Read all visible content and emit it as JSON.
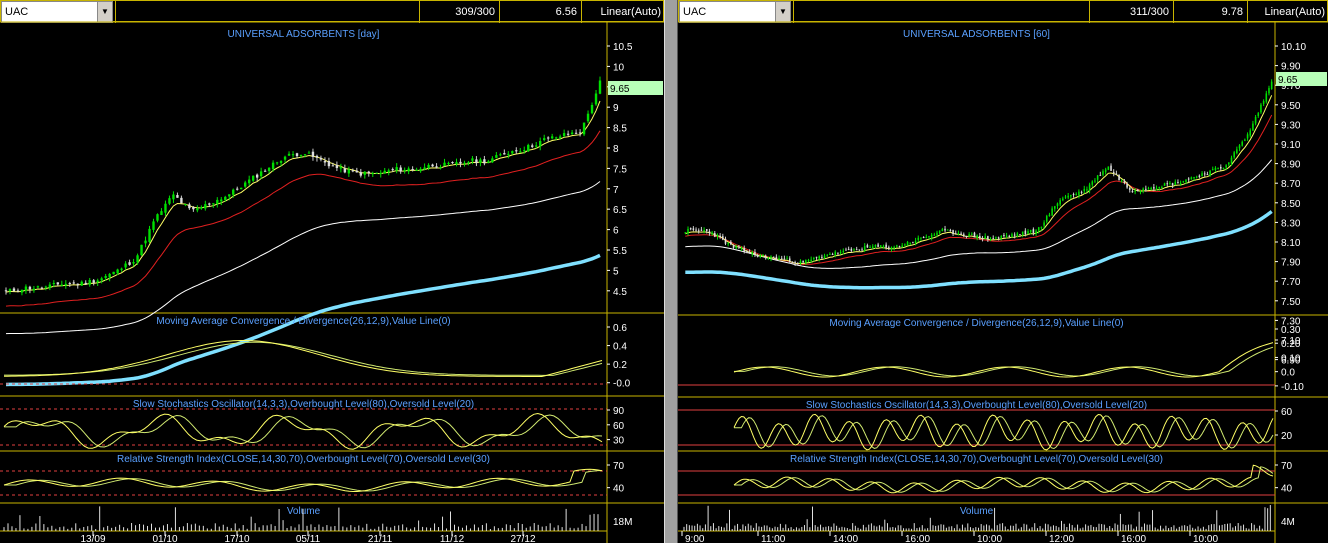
{
  "left": {
    "symbol": "UAC",
    "count": "309/300",
    "value": "6.56",
    "scale": "Linear(Auto)",
    "title": "UNIVERSAL ADSORBENTS [day]",
    "price_badge": "9.65",
    "price_ticks": [
      "10.5",
      "10",
      "9.5",
      "9",
      "8.5",
      "8",
      "7.5",
      "7",
      "6.5",
      "6",
      "5.5",
      "5",
      "4.5"
    ],
    "macd_title": "Moving Average Convergence / Divergence(26,12,9),Value Line(0)",
    "macd_ticks": [
      "0.6",
      "0.4",
      "0.2",
      "-0.0"
    ],
    "stoch_title": "Slow Stochastics Oscillator(14,3,3),Overbought Level(80),Oversold Level(20)",
    "stoch_ticks": [
      "90",
      "60",
      "30"
    ],
    "rsi_title": "Relative Strength Index(CLOSE,14,30,70),Overbought Level(70),Oversold Level(30)",
    "rsi_ticks": [
      "70",
      "40"
    ],
    "volume_title": "Volume",
    "volume_tick": "18M",
    "dates": [
      "13/09",
      "01/10",
      "17/10",
      "05/11",
      "21/11",
      "11/12",
      "27/12"
    ]
  },
  "right": {
    "symbol": "UAC",
    "count": "311/300",
    "value": "9.78",
    "scale": "Linear(Auto)",
    "title": "UNIVERSAL ADSORBENTS [60]",
    "price_badge": "9.65",
    "price_ticks": [
      "10.10",
      "9.90",
      "9.70",
      "9.50",
      "9.30",
      "9.10",
      "8.90",
      "8.70",
      "8.50",
      "8.30",
      "8.10",
      "7.90",
      "7.70",
      "7.50",
      "7.30",
      "7.10",
      "6.90"
    ],
    "macd_title": "Moving Average Convergence / Divergence(26,12,9),Value Line(0)",
    "macd_ticks": [
      "0.30",
      "0.20",
      "0.10",
      "0.0",
      "-0.10"
    ],
    "stoch_title": "Slow Stochastics Oscillator(14,3,3),Overbought Level(80),Oversold Level(20)",
    "stoch_ticks": [
      "60",
      "20"
    ],
    "rsi_title": "Relative Strength Index(CLOSE,14,30,70),Overbought Level(70),Oversold Level(30)",
    "rsi_ticks": [
      "70",
      "40"
    ],
    "volume_title": "Volume",
    "volume_tick": "4M",
    "times": [
      "9:00",
      "11:00",
      "14:00",
      "16:00",
      "10:00",
      "12:00",
      "16:00",
      "10:00"
    ]
  },
  "colors": {
    "up": "#00e000",
    "down": "#ff3030",
    "ma_fast": "#ffff66",
    "ma_mid": "#e02020",
    "ma_slow": "#ffffff",
    "ma_long": "#7fe0ff",
    "title": "#5aa0ff",
    "badge": "#b8ffb8",
    "osc_main": "#ffff66",
    "osc_signal": "#cfe870",
    "level": "#e04040",
    "frame": "#c8b400"
  },
  "chart_data": [
    {
      "type": "candlestick",
      "title": "UNIVERSAL ADSORBENTS [day]",
      "x_labels": [
        "13/09",
        "01/10",
        "17/10",
        "05/11",
        "21/11",
        "11/12",
        "27/12"
      ],
      "ylim": [
        4.3,
        10.7
      ],
      "close_path": [
        4.7,
        4.8,
        4.8,
        4.9,
        4.9,
        5.0,
        5.2,
        5.5,
        6.4,
        7.0,
        6.6,
        6.8,
        7.0,
        7.3,
        7.6,
        7.9,
        8.0,
        7.8,
        7.6,
        7.5,
        7.5,
        7.6,
        7.6,
        7.7,
        7.7,
        7.8,
        7.8,
        8.0,
        8.1,
        8.3,
        8.4,
        8.5,
        9.65
      ],
      "last_price": 9.65
    },
    {
      "type": "candlestick",
      "title": "UNIVERSAL ADSORBENTS [60]",
      "x_labels": [
        "9:00",
        "11:00",
        "14:00",
        "16:00",
        "10:00",
        "12:00",
        "16:00",
        "10:00"
      ],
      "ylim": [
        6.8,
        10.2
      ],
      "close_path": [
        7.8,
        7.8,
        7.6,
        7.5,
        7.45,
        7.4,
        7.5,
        7.55,
        7.6,
        7.6,
        7.7,
        7.8,
        7.75,
        7.7,
        7.75,
        7.8,
        8.2,
        8.3,
        8.6,
        8.3,
        8.35,
        8.4,
        8.5,
        8.6,
        9.0,
        9.65
      ],
      "last_price": 9.65
    }
  ]
}
